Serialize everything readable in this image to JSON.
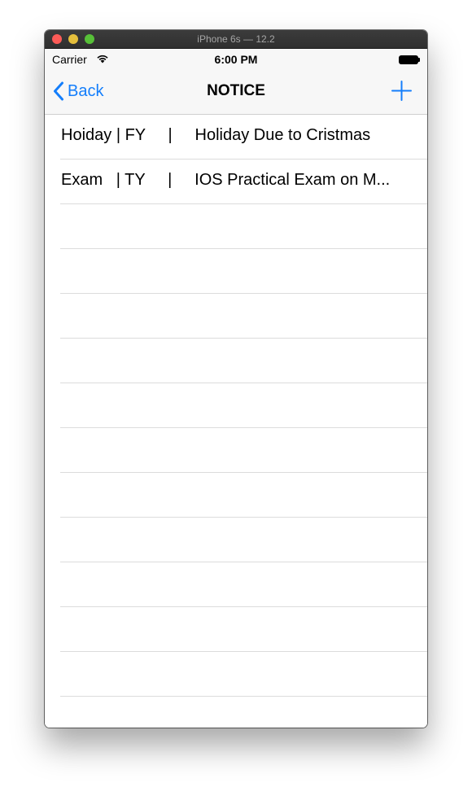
{
  "window": {
    "title": "iPhone 6s — 12.2"
  },
  "status_bar": {
    "carrier": "Carrier",
    "time": "6:00 PM"
  },
  "nav": {
    "back_label": "Back",
    "title": "NOTICE",
    "add_icon": "plus-icon"
  },
  "notices": [
    {
      "type": "Hoiday",
      "class": "FY",
      "title": "Holiday Due to Cristmas"
    },
    {
      "type": "Exam",
      "class": "TY",
      "title": "IOS Practical Exam on M..."
    }
  ],
  "colors": {
    "accent": "#147efb",
    "nav_background": "#f7f7f7",
    "separator": "#dcdcdc"
  }
}
